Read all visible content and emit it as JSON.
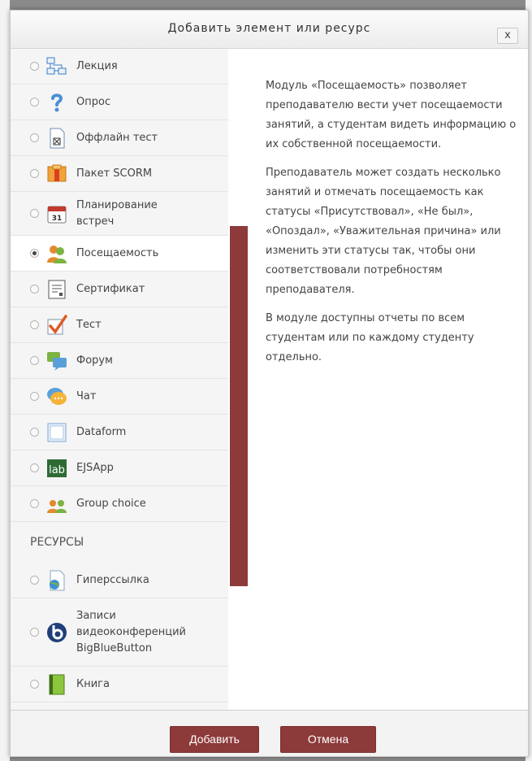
{
  "dialog": {
    "title": "Добавить элемент или ресурс",
    "close": "x"
  },
  "activities": [
    {
      "label": "Лекция",
      "icon": "lesson-icon"
    },
    {
      "label": "Опрос",
      "icon": "question-mark-icon"
    },
    {
      "label": "Оффлайн тест",
      "icon": "offline-quiz-icon"
    },
    {
      "label": "Пакет SCORM",
      "icon": "scorm-package-icon"
    },
    {
      "label": "Планирование встреч",
      "icon": "calendar-icon"
    },
    {
      "label": "Посещаемость",
      "icon": "attendance-icon"
    },
    {
      "label": "Сертификат",
      "icon": "certificate-icon"
    },
    {
      "label": "Тест",
      "icon": "quiz-check-icon"
    },
    {
      "label": "Форум",
      "icon": "forum-icon"
    },
    {
      "label": "Чат",
      "icon": "chat-icon"
    },
    {
      "label": "Dataform",
      "icon": "dataform-icon"
    },
    {
      "label": "EJSApp",
      "icon": "lab-icon"
    },
    {
      "label": "Group choice",
      "icon": "group-choice-icon"
    }
  ],
  "resources_heading": "РЕСУРСЫ",
  "resources": [
    {
      "label": "Гиперссылка",
      "icon": "url-icon"
    },
    {
      "label": "Записи видеоконференций BigBlueButton",
      "icon": "bigbluebutton-icon"
    },
    {
      "label": "Книга",
      "icon": "book-icon"
    }
  ],
  "selected": "Посещаемость",
  "description": [
    "Модуль «Посещаемость» позволяет преподавателю вести учет посещаемости занятий, а студентам видеть информацию о их собственной посещаемости.",
    "Преподаватель может создать несколько занятий и отмечать посещаемость как статусы «Присутствовал», «Не был», «Опоздал», «Уважительная причина» или изменить эти статусы так, чтобы они соответствовали потребностям преподавателя.",
    "В модуле доступны отчеты по всем студентам или по каждому студенту отдельно."
  ],
  "footer": {
    "add_label": "Добавить",
    "cancel_label": "Отмена"
  },
  "colors": {
    "accent": "#8d3a3a"
  }
}
